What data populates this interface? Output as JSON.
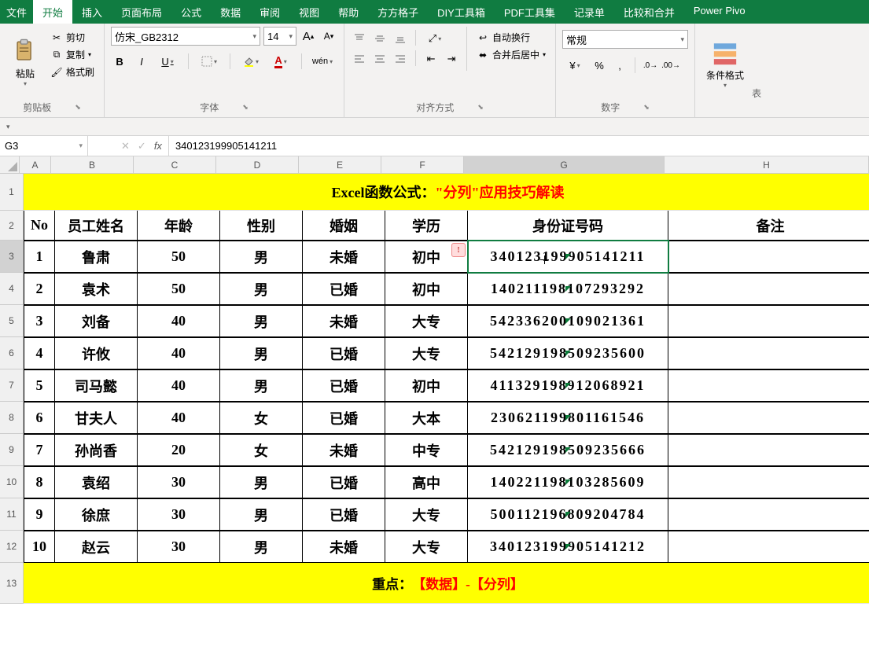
{
  "menubar": {
    "items": [
      "文件",
      "开始",
      "插入",
      "页面布局",
      "公式",
      "数据",
      "审阅",
      "视图",
      "帮助",
      "方方格子",
      "DIY工具箱",
      "PDF工具集",
      "记录单",
      "比较和合并",
      "Power Pivo"
    ],
    "active_index": 1
  },
  "ribbon": {
    "clipboard": {
      "paste": "粘贴",
      "cut": "剪切",
      "copy": "复制",
      "format_painter": "格式刷",
      "label": "剪贴板"
    },
    "font": {
      "name": "仿宋_GB2312",
      "size": "14",
      "increase": "A",
      "decrease": "A",
      "bold": "B",
      "italic": "I",
      "underline": "U",
      "wen": "wén",
      "label": "字体"
    },
    "align": {
      "wrap": "自动换行",
      "merge": "合并后居中",
      "label": "对齐方式"
    },
    "number": {
      "format": "常规",
      "percent": "%",
      "comma": ",",
      "label": "数字"
    },
    "cond": {
      "label": "条件格式"
    },
    "table_label": "表"
  },
  "formula_bar": {
    "cell_ref": "G3",
    "fx": "fx",
    "value": "340123199905141211"
  },
  "columns": [
    "A",
    "B",
    "C",
    "D",
    "E",
    "F",
    "G",
    "H"
  ],
  "row_nums": [
    "1",
    "2",
    "3",
    "4",
    "5",
    "6",
    "7",
    "8",
    "9",
    "10",
    "11",
    "12",
    "13"
  ],
  "sheet": {
    "title_prefix": "Excel函数公式：",
    "title_highlight": "\"分列\"应用技巧解读",
    "headers": [
      "No",
      "员工姓名",
      "年龄",
      "性别",
      "婚姻",
      "学历",
      "身份证号码",
      "备注"
    ],
    "rows": [
      {
        "no": "1",
        "name": "鲁肃",
        "age": "50",
        "gender": "男",
        "marriage": "未婚",
        "edu": "初中",
        "id": "340123199905141211",
        "remark": ""
      },
      {
        "no": "2",
        "name": "袁术",
        "age": "50",
        "gender": "男",
        "marriage": "已婚",
        "edu": "初中",
        "id": "140211198107293292",
        "remark": ""
      },
      {
        "no": "3",
        "name": "刘备",
        "age": "40",
        "gender": "男",
        "marriage": "未婚",
        "edu": "大专",
        "id": "542336200109021361",
        "remark": ""
      },
      {
        "no": "4",
        "name": "许攸",
        "age": "40",
        "gender": "男",
        "marriage": "已婚",
        "edu": "大专",
        "id": "542129198509235600",
        "remark": ""
      },
      {
        "no": "5",
        "name": "司马懿",
        "age": "40",
        "gender": "男",
        "marriage": "已婚",
        "edu": "初中",
        "id": "411329198912068921",
        "remark": ""
      },
      {
        "no": "6",
        "name": "甘夫人",
        "age": "40",
        "gender": "女",
        "marriage": "已婚",
        "edu": "大本",
        "id": "230621199801161546",
        "remark": ""
      },
      {
        "no": "7",
        "name": "孙尚香",
        "age": "20",
        "gender": "女",
        "marriage": "未婚",
        "edu": "中专",
        "id": "542129198509235666",
        "remark": ""
      },
      {
        "no": "8",
        "name": "袁绍",
        "age": "30",
        "gender": "男",
        "marriage": "已婚",
        "edu": "高中",
        "id": "140221198103285609",
        "remark": ""
      },
      {
        "no": "9",
        "name": "徐庶",
        "age": "30",
        "gender": "男",
        "marriage": "已婚",
        "edu": "大专",
        "id": "500112196809204784",
        "remark": ""
      },
      {
        "no": "10",
        "name": "赵云",
        "age": "30",
        "gender": "男",
        "marriage": "未婚",
        "edu": "大专",
        "id": "340123199905141212",
        "remark": ""
      }
    ],
    "footer_prefix": "重点：",
    "footer_highlight": "【数据】-【分列】"
  },
  "row_heights": {
    "header": 22,
    "title": 47,
    "head": 38,
    "data": 41,
    "footer": 52
  },
  "selected_cell": "G3"
}
